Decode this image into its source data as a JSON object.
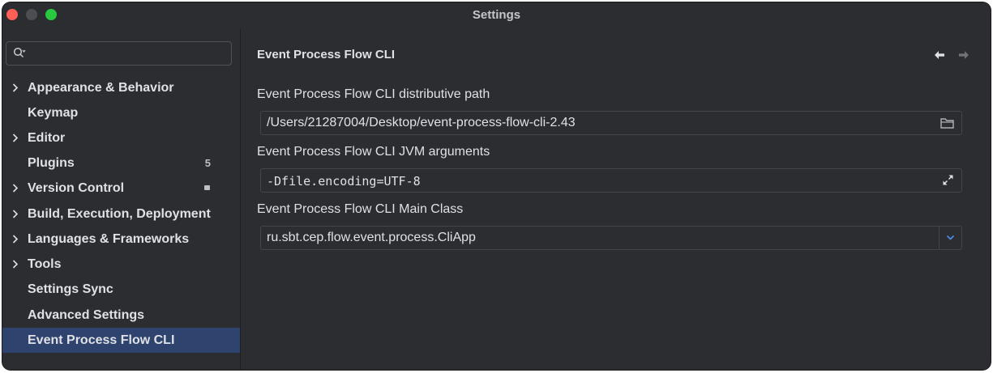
{
  "window": {
    "title": "Settings"
  },
  "search": {
    "placeholder": ""
  },
  "sidebar": {
    "items": [
      {
        "label": "Appearance & Behavior",
        "expandable": true
      },
      {
        "label": "Keymap",
        "expandable": false
      },
      {
        "label": "Editor",
        "expandable": true
      },
      {
        "label": "Plugins",
        "expandable": false,
        "badge": "5"
      },
      {
        "label": "Version Control",
        "expandable": true
      },
      {
        "label": "Build, Execution, Deployment",
        "expandable": true
      },
      {
        "label": "Languages & Frameworks",
        "expandable": true
      },
      {
        "label": "Tools",
        "expandable": true
      },
      {
        "label": "Settings Sync",
        "expandable": false
      },
      {
        "label": "Advanced Settings",
        "expandable": false
      },
      {
        "label": "Event Process Flow CLI",
        "expandable": false,
        "selected": true
      }
    ]
  },
  "page": {
    "title": "Event Process Flow CLI",
    "fields": [
      {
        "label": "Event Process Flow CLI distributive path",
        "value": "/Users/21287004/Desktop/event-process-flow-cli-2.43",
        "icon": "folder-icon"
      },
      {
        "label": "Event Process Flow CLI JVM arguments",
        "value": "-Dfile.encoding=UTF-8",
        "icon": "expand-icon"
      },
      {
        "label": "Event Process Flow CLI Main Class",
        "value": "ru.sbt.cep.flow.event.process.CliApp",
        "icon": "chevron-down-icon"
      }
    ]
  },
  "colors": {
    "background": "#2b2d30",
    "selection": "#2e436e",
    "text": "#dfe1e5",
    "border": "#43454a"
  }
}
